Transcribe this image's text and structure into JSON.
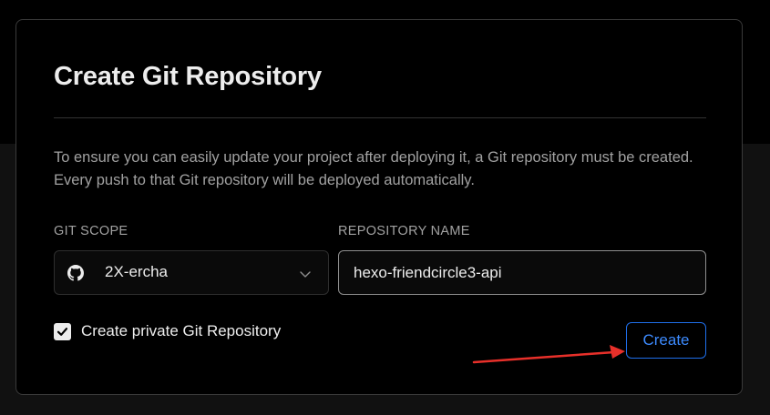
{
  "modal": {
    "title": "Create Git Repository",
    "description": "To ensure you can easily update your project after deploying it, a Git repository must be created. Every push to that Git repository will be deployed automatically."
  },
  "form": {
    "git_scope_label": "GIT SCOPE",
    "git_scope_value": "2X-ercha",
    "repository_name_label": "REPOSITORY NAME",
    "repository_name_value": "hexo-friendcircle3-api",
    "private_checkbox_label": "Create private Git Repository",
    "private_checked": true
  },
  "actions": {
    "create_label": "Create"
  },
  "icons": {
    "scope": "github-icon",
    "dropdown": "chevron-down-icon",
    "checkbox": "checkmark-icon",
    "annotation": "red-arrow-icon"
  },
  "colors": {
    "accent": "#1f6feb",
    "annotation_arrow": "#e8302a"
  }
}
